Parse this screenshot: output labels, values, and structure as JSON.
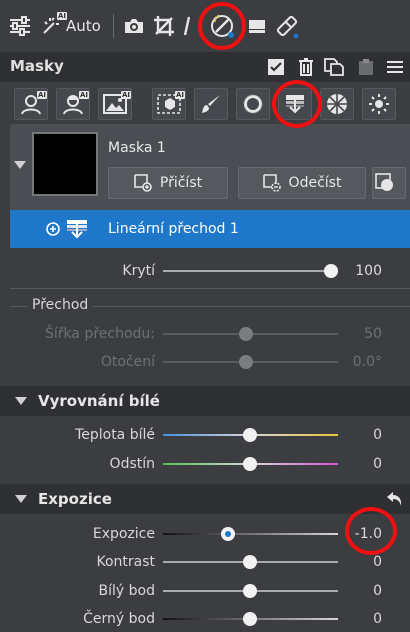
{
  "toolbar": {
    "auto_label": "Auto",
    "ai_badge": "AI"
  },
  "masks": {
    "title": "Masky",
    "tools_ai_badge": "AI"
  },
  "mask_item": {
    "name": "Maska 1",
    "add_label": "Přičíst",
    "subtract_label": "Odečíst"
  },
  "layer": {
    "name": "Lineární přechod 1"
  },
  "opacity": {
    "label": "Krytí",
    "value": "100"
  },
  "gradient": {
    "section_label": "Přechod",
    "width_label": "Šířka přechodu:",
    "width_value": "50",
    "rotation_label": "Otočení",
    "rotation_value": "0.0°"
  },
  "white_balance": {
    "title": "Vyrovnání bílé",
    "temperature_label": "Teplota bílé",
    "temperature_value": "0",
    "tint_label": "Odstín",
    "tint_value": "0"
  },
  "exposure": {
    "title": "Expozice",
    "exposure_label": "Expozice",
    "exposure_value": "-1.0",
    "contrast_label": "Kontrast",
    "contrast_value": "0",
    "white_point_label": "Bílý bod",
    "white_point_value": "0",
    "black_point_label": "Černý bod",
    "black_point_value": "0"
  },
  "colors": {
    "accent": "#1f77c9",
    "highlight": "#ee1111"
  }
}
